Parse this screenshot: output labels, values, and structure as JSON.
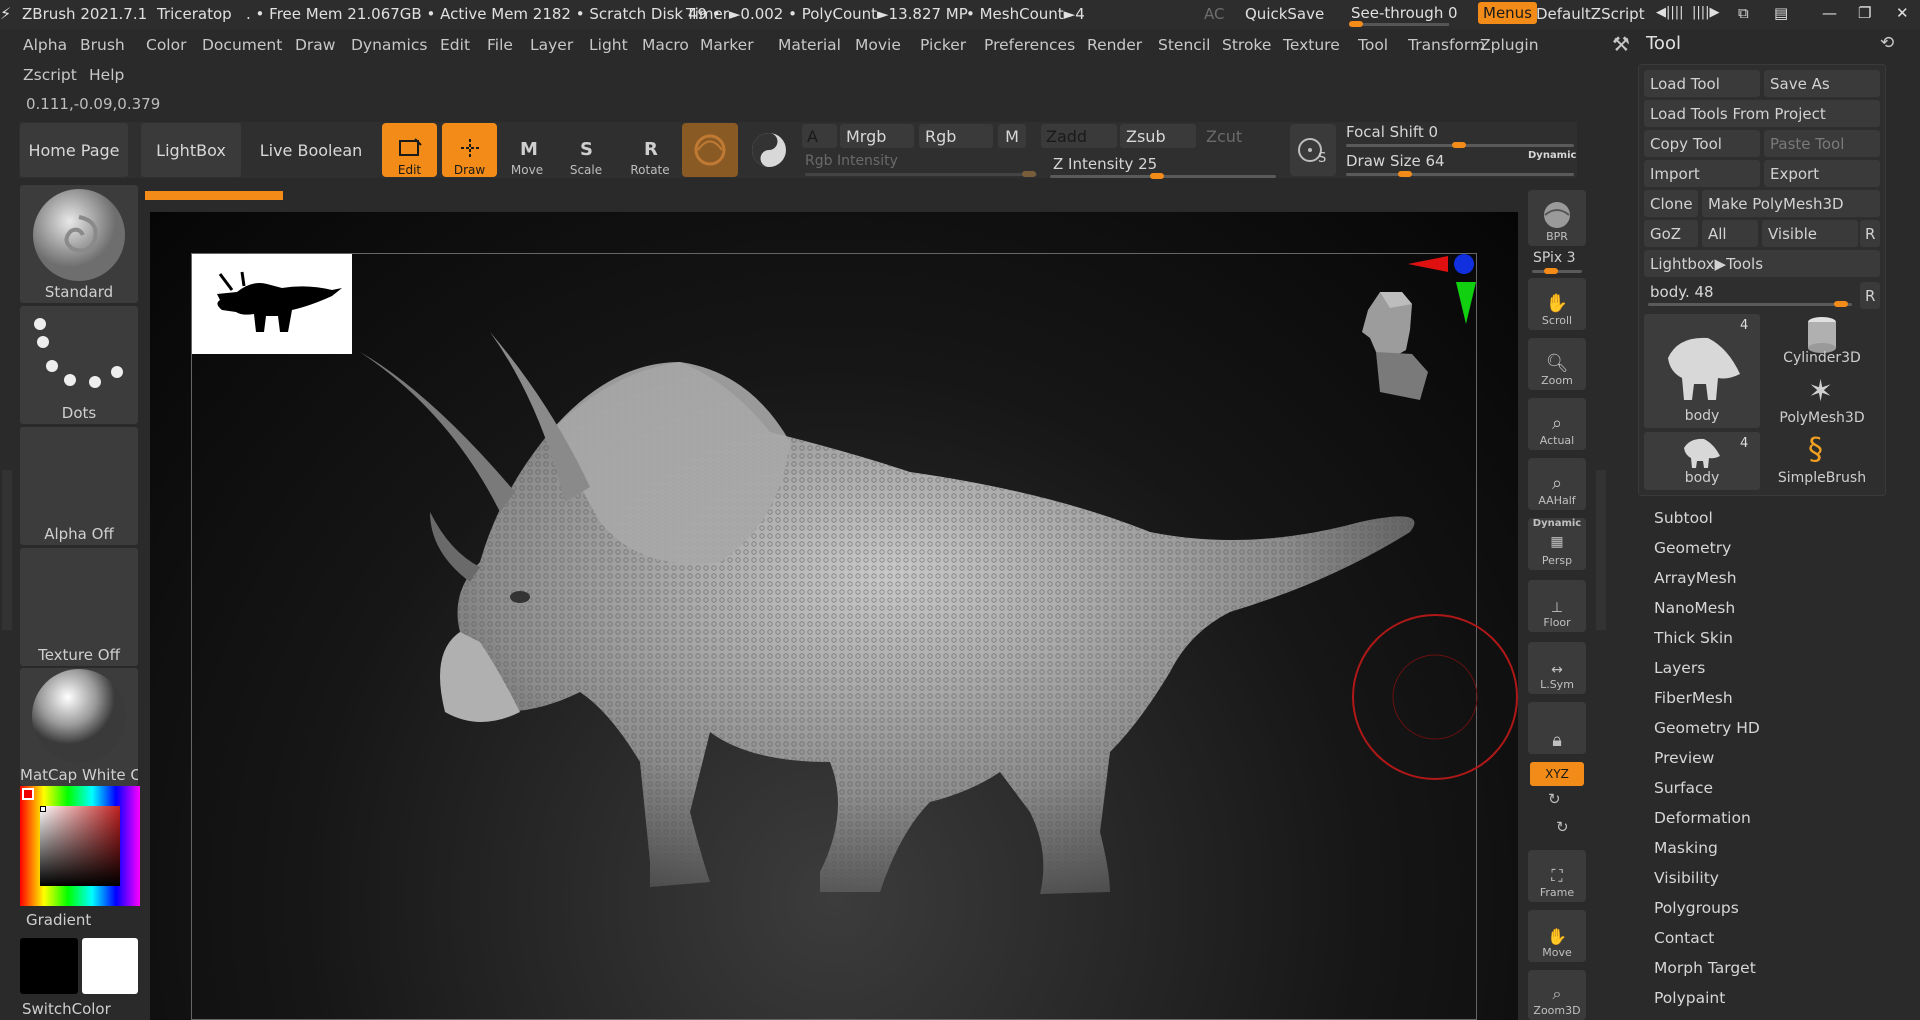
{
  "titlebar": {
    "app": "ZBrush 2021.7.1",
    "file": "Triceratop",
    "stats": ". • Free Mem 21.067GB • Active Mem 2182 • Scratch Disk 49 •",
    "timer": "Timer►0.002 • PolyCount►13.827 MP",
    "meshcount": "• MeshCount►4",
    "ac": "AC",
    "quicksave": "QuickSave",
    "seethrough": "See-through",
    "seethrough_value": "0",
    "menus": "Menus",
    "script": "DefaultZScript"
  },
  "menubar": [
    "Alpha",
    "Brush",
    "Color",
    "Document",
    "Draw",
    "Dynamics",
    "Edit",
    "File",
    "Layer",
    "Light",
    "Macro",
    "Marker",
    "Material",
    "Movie",
    "Picker",
    "Preferences",
    "Render",
    "Stencil",
    "Stroke",
    "Texture",
    "Tool",
    "Transform",
    "Zplugin"
  ],
  "menubar2": [
    "Zscript",
    "Help"
  ],
  "coords": "0.111,-0.09,0.379",
  "toolbar": {
    "home": "Home Page",
    "lightbox": "LightBox",
    "liveboolean": "Live Boolean",
    "edit": "Edit",
    "draw": "Draw",
    "move": "Move",
    "scale": "Scale",
    "rotate": "Rotate",
    "a": "A",
    "mrgb": "Mrgb",
    "rgb": "Rgb",
    "m": "M",
    "zadd": "Zadd",
    "zsub": "Zsub",
    "zcut": "Zcut",
    "rgb_intensity": "Rgb Intensity",
    "z_intensity": "Z Intensity 25",
    "focal_shift": "Focal Shift 0",
    "draw_size": "Draw Size 64",
    "dynamic": "Dynamic"
  },
  "lefttray": {
    "brush": "Standard",
    "stroke": "Dots",
    "alpha": "Alpha Off",
    "texture": "Texture Off",
    "material": "MatCap White C",
    "gradient": "Gradient",
    "switchcolor": "SwitchColor"
  },
  "shelf": {
    "bpr": "BPR",
    "spix": "SPix 3",
    "scroll": "Scroll",
    "zoom": "Zoom",
    "actual": "Actual",
    "aahalf": "AAHalf",
    "dynamic": "Dynamic",
    "persp": "Persp",
    "floor": "Floor",
    "lsym": "L.Sym",
    "xyz": "XYZ",
    "frame": "Frame",
    "move": "Move",
    "zoom3d": "Zoom3D"
  },
  "toolpanel": {
    "title": "Tool",
    "load_tool": "Load Tool",
    "save_as": "Save As",
    "load_from_project": "Load Tools From Project",
    "copy_tool": "Copy Tool",
    "paste_tool": "Paste Tool",
    "import": "Import",
    "export": "Export",
    "clone": "Clone",
    "make_polymesh": "Make PolyMesh3D",
    "goz": "GoZ",
    "all": "All",
    "visible": "Visible",
    "r": "R",
    "lightbox_tools": "Lightbox▶Tools",
    "body_slider": "body. 48",
    "thumbs": {
      "body1": "body",
      "body1_count": "4",
      "cylinder": "Cylinder3D",
      "polymesh": "PolyMesh3D",
      "body2": "body",
      "body2_count": "4",
      "simplebrush": "SimpleBrush"
    },
    "subpalettes": [
      "Subtool",
      "Geometry",
      "ArrayMesh",
      "NanoMesh",
      "Thick Skin",
      "Layers",
      "FiberMesh",
      "Geometry HD",
      "Preview",
      "Surface",
      "Deformation",
      "Masking",
      "Visibility",
      "Polygroups",
      "Contact",
      "Morph Target",
      "Polypaint"
    ]
  },
  "colors": {
    "accent": "#f28b17",
    "bg": "#2a2a2a",
    "canvas": "#0c0c0c",
    "panel": "#3a3a3a"
  }
}
